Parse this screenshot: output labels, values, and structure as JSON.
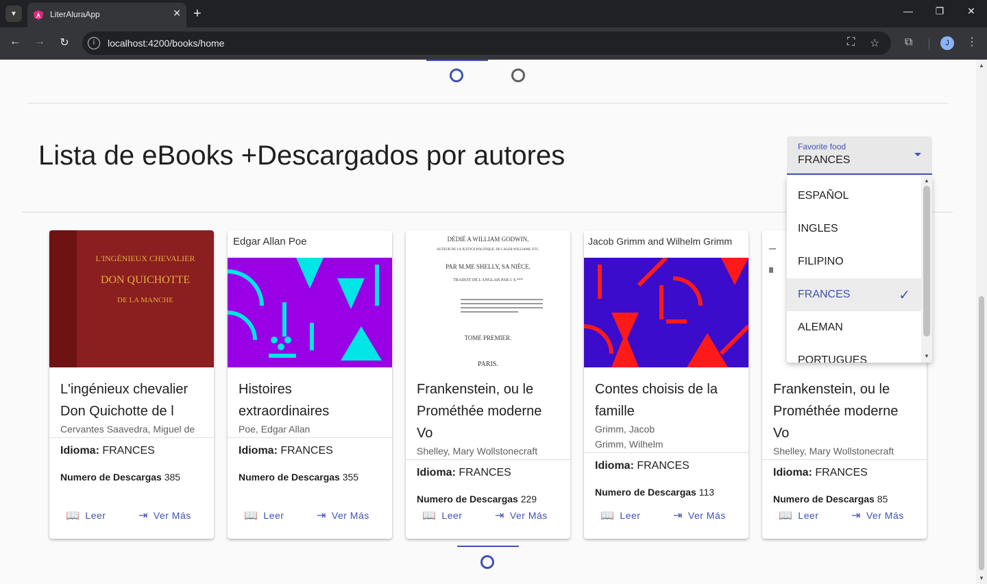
{
  "browser": {
    "tab_title": "LiterAluraApp",
    "url": "localhost:4200/books/home",
    "avatar_initial": "J"
  },
  "header": {
    "title": "Lista de eBooks +Descargados por autores"
  },
  "language_select": {
    "label": "Favorite food",
    "value": "FRANCES",
    "options": [
      "ESPAÑOL",
      "INGLES",
      "FILIPINO",
      "FRANCES",
      "ALEMAN",
      "PORTUGUES"
    ],
    "selected_index": 3
  },
  "labels": {
    "idioma": "Idioma:",
    "descargas": "Numero de Descargas",
    "leer": "Leer",
    "ver_mas": "Ver Más"
  },
  "books": [
    {
      "title": "L'ingénieux chevalier Don Quichotte de l",
      "authors": [
        "Cervantes Saavedra, Miguel de"
      ],
      "language": "FRANCES",
      "downloads": "385",
      "cover": {
        "line1": "L'INGÉNIEUX CHEVALIER",
        "line2": "DON QUICHOTTE",
        "line3": "DE LA MANCHE"
      }
    },
    {
      "title": "Histoires extraordinaires",
      "authors": [
        "Poe, Edgar Allan"
      ],
      "language": "FRANCES",
      "downloads": "355",
      "cover": {
        "author": "Edgar Allan Poe"
      }
    },
    {
      "title": "Frankenstein, ou le Prométhée moderne Vo",
      "authors": [
        "Shelley, Mary Wollstonecraft"
      ],
      "language": "FRANCES",
      "downloads": "229",
      "cover": {
        "line1": "DÉDIÉ A WILLIAM GODWIN,",
        "line2": "AUTEUR DE LA JUSTICE POLITIQUE, DE CALEB WILLIAMS, ETC.",
        "line3": "PAR M.ME SHELLY, SA NIÈCE.",
        "line4": "TRADUIT DE L'ANGLAIS PAR J. S.***",
        "line5": "TOME PREMIER.",
        "line6": "PARIS."
      }
    },
    {
      "title": "Contes choisis de la famille",
      "authors": [
        "Grimm, Jacob",
        "Grimm, Wilhelm"
      ],
      "language": "FRANCES",
      "downloads": "113",
      "cover": {
        "author": "Jacob Grimm and Wilhelm Grimm"
      }
    },
    {
      "title": "Frankenstein, ou le Prométhée moderne Vo",
      "authors": [
        "Shelley, Mary Wollstonecraft"
      ],
      "language": "FRANCES",
      "downloads": "85"
    }
  ],
  "colors": {
    "primary": "#3f51b5",
    "don_quichotte_cover": "#8b1e1e",
    "poe_cover": "#9a00e6",
    "poe_shapes": "#00e5e5",
    "grimm_cover": "#3b0ccc",
    "grimm_shapes": "#ff1a1a"
  }
}
